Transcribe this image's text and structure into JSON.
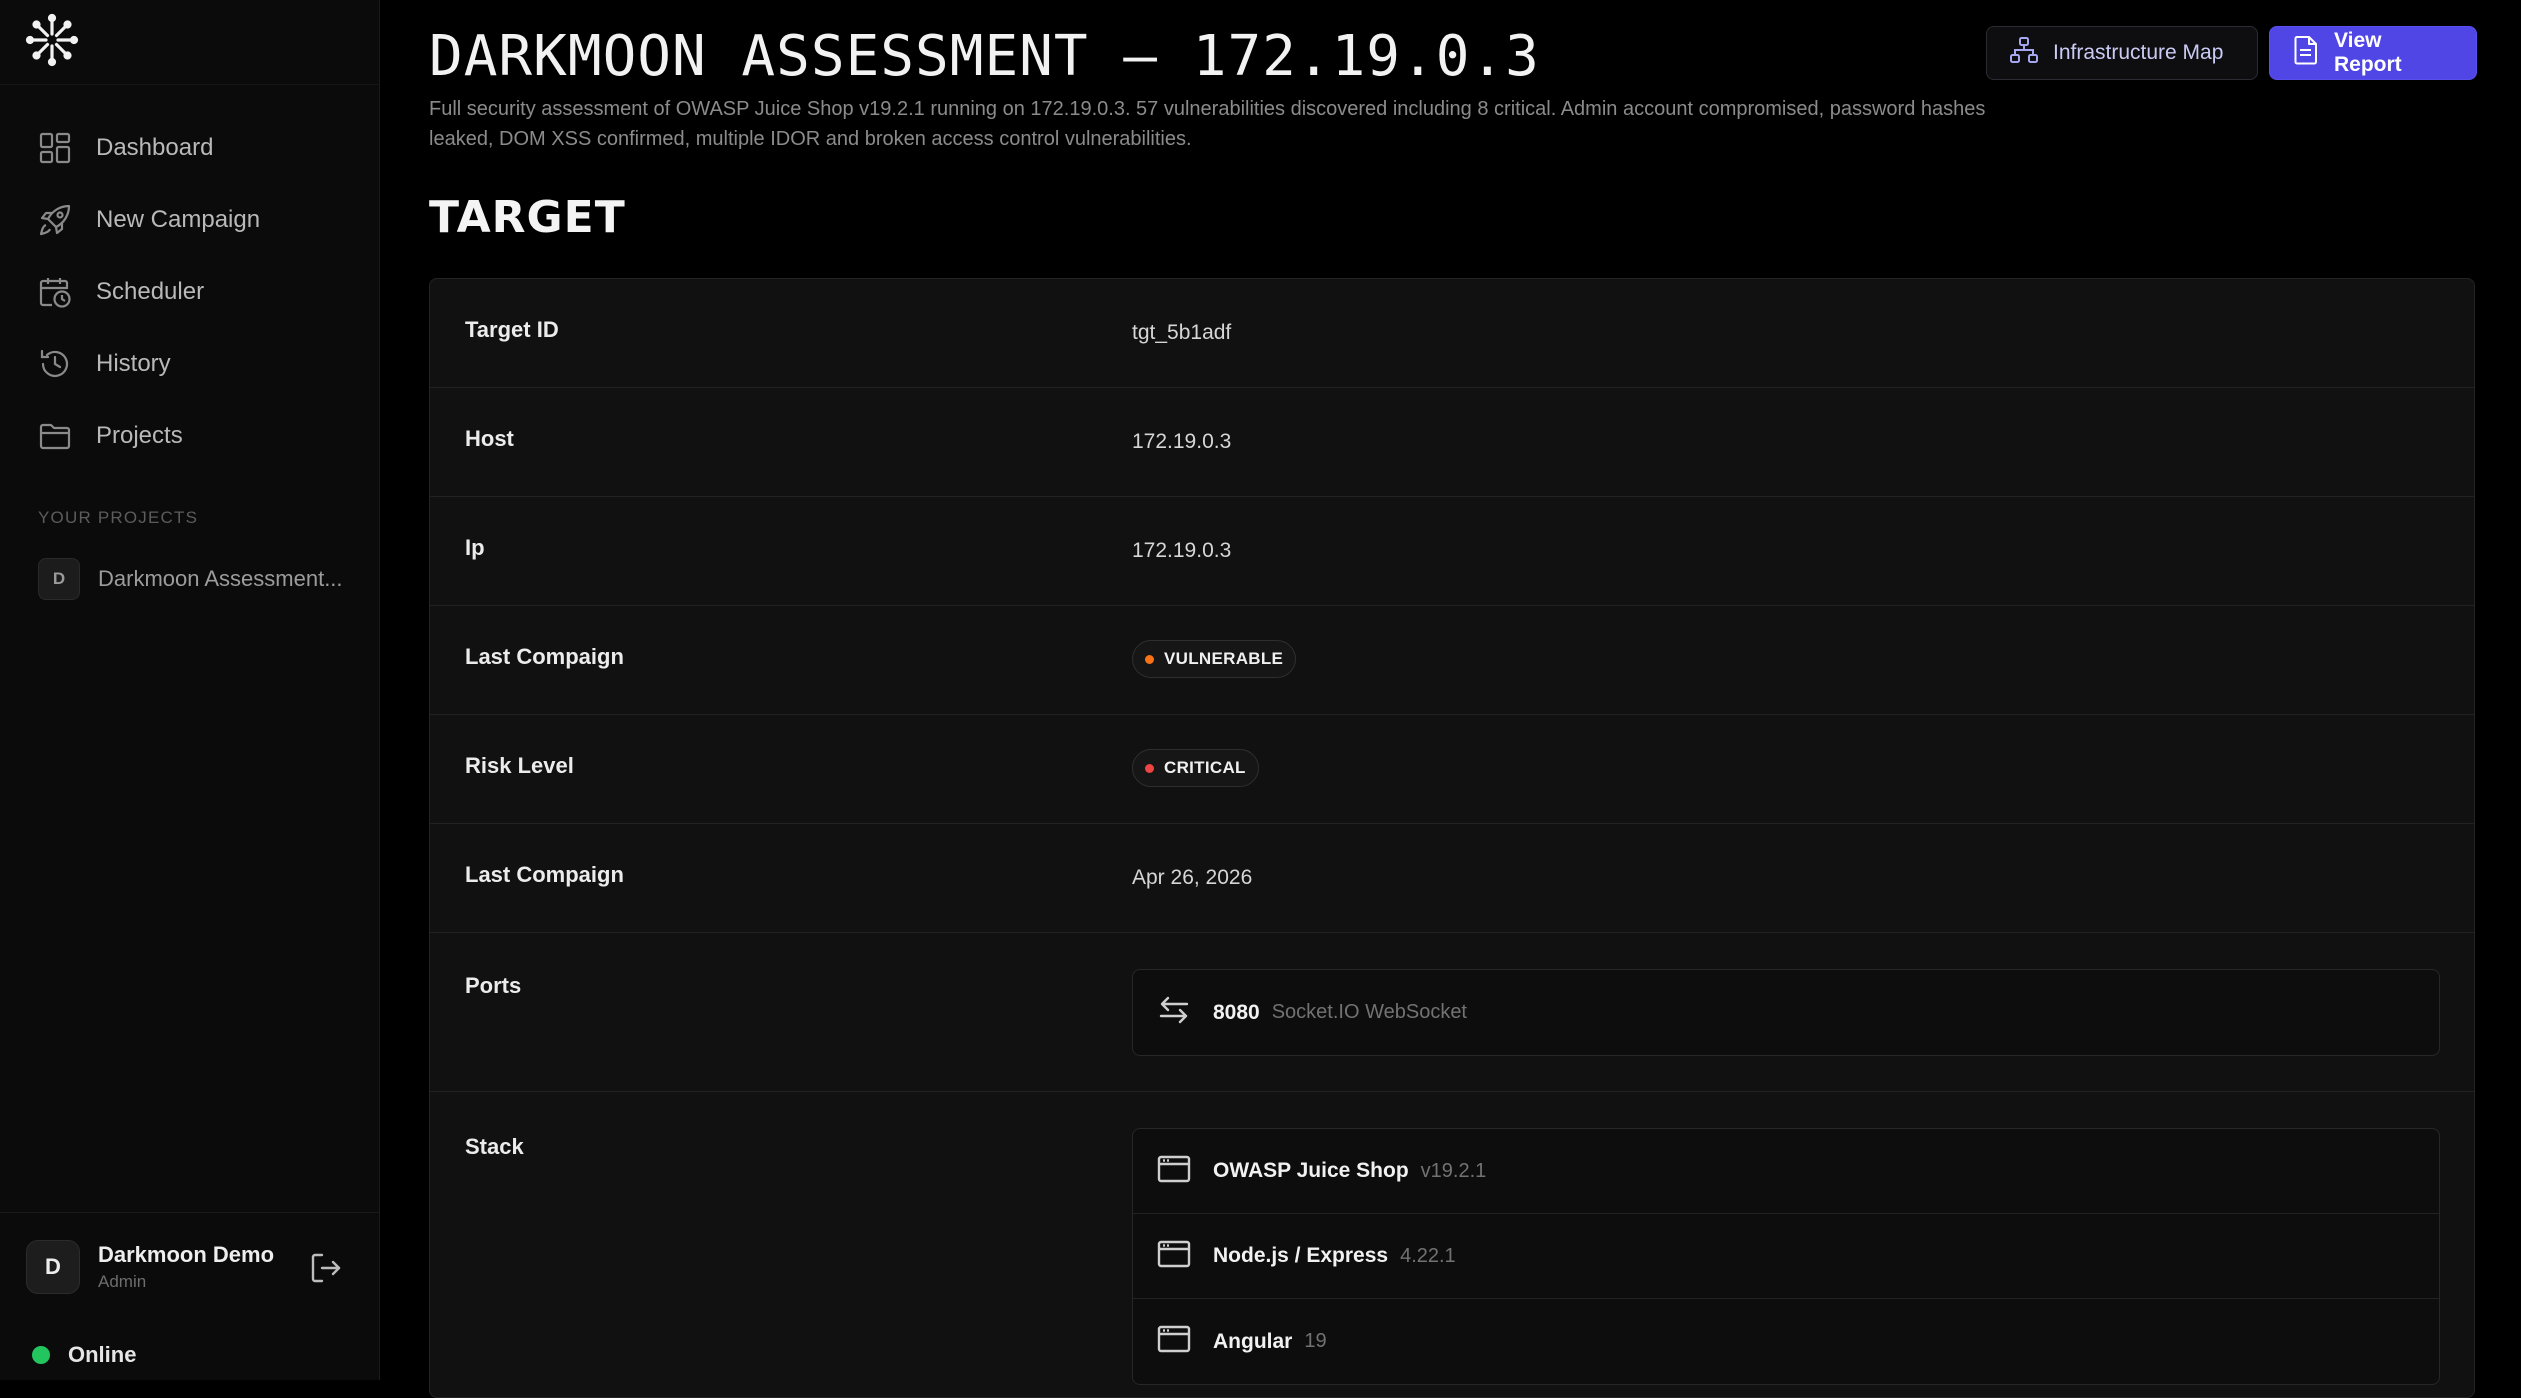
{
  "sidebar": {
    "nav": [
      {
        "label": "Dashboard",
        "icon": "dashboard-icon"
      },
      {
        "label": "New Campaign",
        "icon": "rocket-icon"
      },
      {
        "label": "Scheduler",
        "icon": "calendar-clock-icon"
      },
      {
        "label": "History",
        "icon": "history-icon"
      },
      {
        "label": "Projects",
        "icon": "folder-icon"
      }
    ],
    "section_label": "YOUR PROJECTS",
    "project": {
      "initial": "D",
      "label": "Darkmoon Assessment..."
    },
    "user": {
      "initial": "D",
      "name": "Darkmoon Demo",
      "role": "Admin"
    },
    "status": {
      "label": "Online",
      "color": "#22c55e"
    }
  },
  "header": {
    "title": "DARKMOON ASSESSMENT – 172.19.0.3",
    "description": "Full security assessment of OWASP Juice Shop v19.2.1 running on 172.19.0.3. 57 vulnerabilities discovered including 8 critical. Admin account compromised, password hashes leaked, DOM XSS confirmed, multiple IDOR and broken access control vulnerabilities.",
    "infra_button": "Infrastructure Map",
    "report_button": "View Report"
  },
  "section_title": "TARGET",
  "target": {
    "target_id": {
      "label": "Target ID",
      "value": "tgt_5b1adf"
    },
    "host": {
      "label": "Host",
      "value": "172.19.0.3"
    },
    "ip": {
      "label": "Ip",
      "value": "172.19.0.3"
    },
    "last_campaign_status": {
      "label": "Last Compaign",
      "value": "VULNERABLE",
      "dot_color": "#f97316"
    },
    "risk_level": {
      "label": "Risk Level",
      "value": "CRITICAL",
      "dot_color": "#ef4444"
    },
    "last_campaign_date": {
      "label": "Last Compaign",
      "value": "Apr 26, 2026"
    },
    "ports": {
      "label": "Ports",
      "items": [
        {
          "port": "8080",
          "service": "Socket.IO WebSocket"
        }
      ]
    },
    "stack": {
      "label": "Stack",
      "items": [
        {
          "name": "OWASP Juice Shop",
          "version": "v19.2.1"
        },
        {
          "name": "Node.js / Express",
          "version": "4.22.1"
        },
        {
          "name": "Angular",
          "version": "19"
        }
      ]
    }
  },
  "colors": {
    "accent": "#5046e5",
    "background": "#000000",
    "panel": "#111111"
  }
}
